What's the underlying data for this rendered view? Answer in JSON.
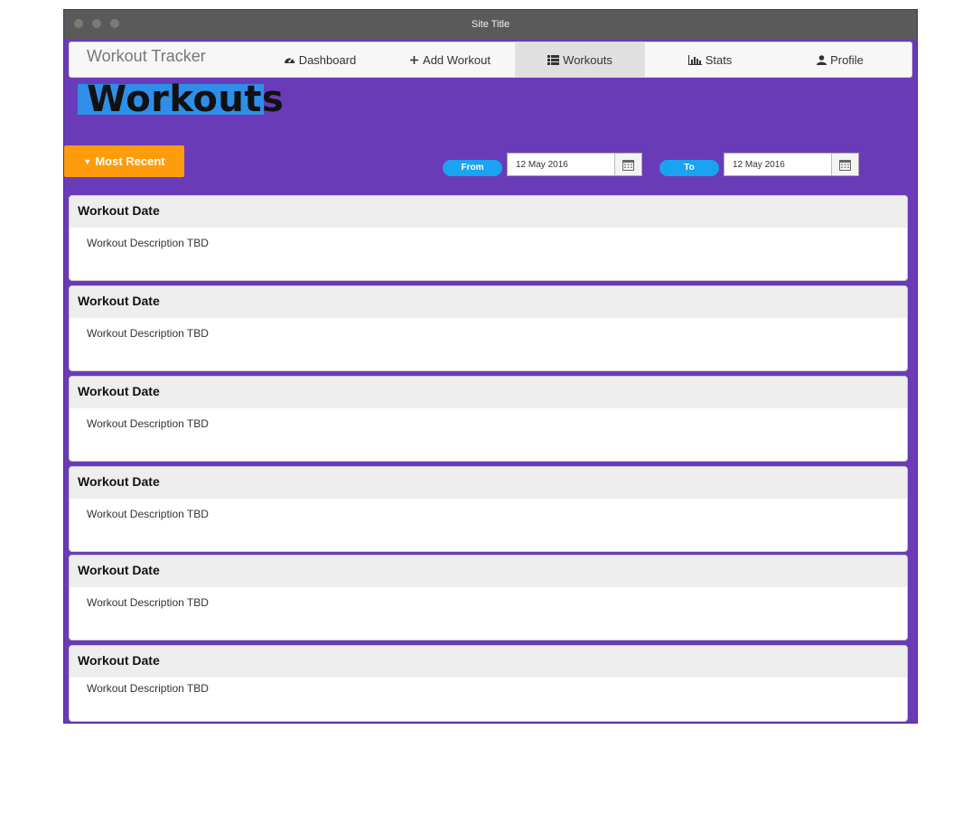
{
  "window": {
    "title": "Site Title"
  },
  "navbar": {
    "brand": "Workout Tracker",
    "items": [
      {
        "label": "Dashboard",
        "icon": "dashboard-icon",
        "active": false
      },
      {
        "label": "Add Workout",
        "icon": "plus-icon",
        "active": false
      },
      {
        "label": "Workouts",
        "icon": "list-icon",
        "active": true
      },
      {
        "label": "Stats",
        "icon": "bar-chart-icon",
        "active": false
      },
      {
        "label": "Profile",
        "icon": "user-icon",
        "active": false
      }
    ]
  },
  "page": {
    "title": "Workouts"
  },
  "filters": {
    "sort_label": "Most Recent",
    "from_label": "From",
    "from_value": "12 May 2016",
    "to_label": "To",
    "to_value": "12 May 2016"
  },
  "workouts": [
    {
      "date": "Workout Date",
      "description": "Workout Description TBD"
    },
    {
      "date": "Workout Date",
      "description": "Workout Description TBD"
    },
    {
      "date": "Workout Date",
      "description": "Workout Description TBD"
    },
    {
      "date": "Workout Date",
      "description": "Workout Description TBD"
    },
    {
      "date": "Workout Date",
      "description": "Workout Description TBD"
    },
    {
      "date": "Workout Date",
      "description": "Workout Description TBD"
    }
  ],
  "colors": {
    "background": "#6a3bb8",
    "accent": "#ff9c0c",
    "date_label": "#1aa3f0",
    "title_highlight": "#2f8ee8"
  }
}
